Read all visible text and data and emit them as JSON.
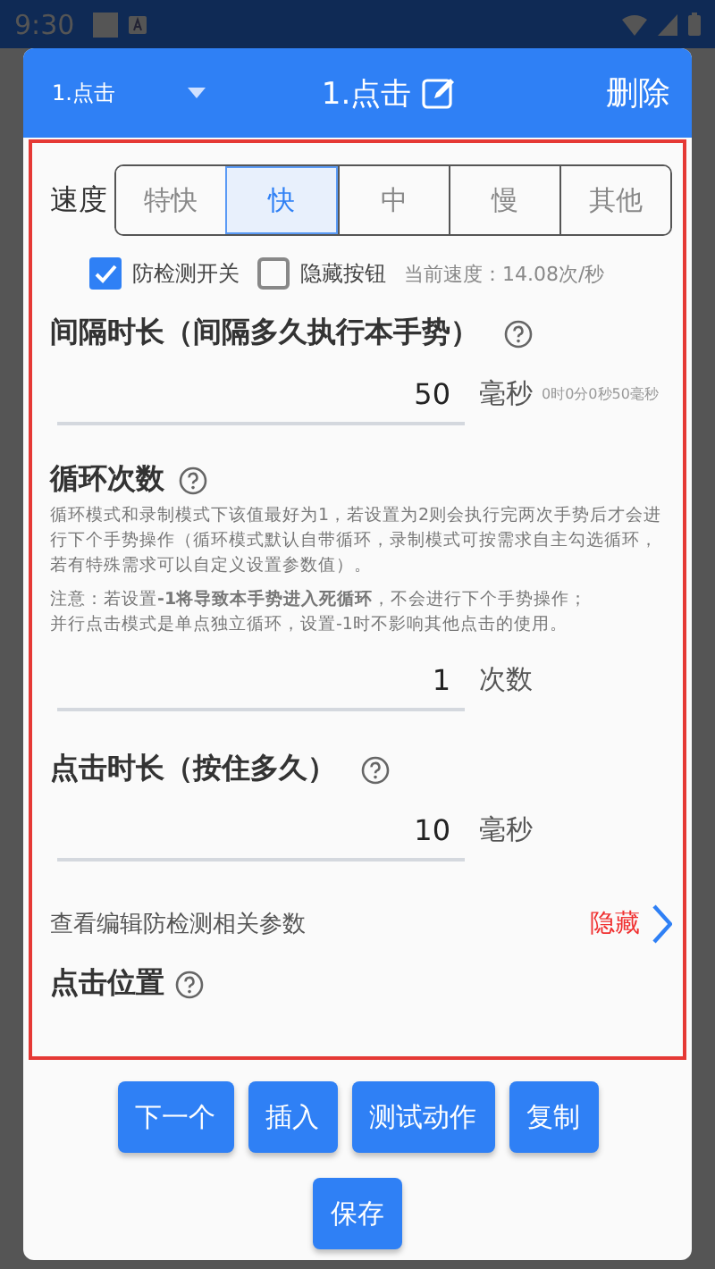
{
  "status_bar": {
    "time": "9:30"
  },
  "header": {
    "dropdown": "1.点击",
    "title": "1.点击",
    "delete": "删除"
  },
  "speed": {
    "label": "速度",
    "options": [
      {
        "label": "特快",
        "selected": false
      },
      {
        "label": "快",
        "selected": true
      },
      {
        "label": "中",
        "selected": false
      },
      {
        "label": "慢",
        "selected": false
      },
      {
        "label": "其他",
        "selected": false
      }
    ]
  },
  "checkboxes": [
    {
      "label": "防检测开关",
      "checked": true
    },
    {
      "label": "隐藏按钮",
      "checked": false
    }
  ],
  "current_speed": "当前速度：14.08次/秒",
  "interval": {
    "title": "间隔时长（间隔多久执行本手势）",
    "value": "50",
    "unit": "毫秒",
    "note": "0时0分0秒50毫秒"
  },
  "loop": {
    "title": "循环次数",
    "description": "循环模式和录制模式下该值最好为1，若设置为2则会执行完两次手势后才会进行下个手势操作（循环模式默认自带循环，录制模式可按需求自主勾选循环，若有特殊需求可以自定义设置参数值）。",
    "warning": [
      "注意：若设置**-1将导致本手势进入死循环**，不会进行下个手势操作；",
      "并行点击模式是单点独立循环，设置-1时不影响其他点击的使用。"
    ],
    "value": "1",
    "unit": "次数"
  },
  "click_duration": {
    "title": "点击时长（按住多久）",
    "value": "10",
    "unit": "毫秒"
  },
  "anti_detect": {
    "label": "查看编辑防检测相关参数",
    "action": "隐藏"
  },
  "position": {
    "title": "点击位置"
  },
  "buttons": [
    "下一个",
    "插入",
    "测试动作",
    "复制"
  ],
  "save": "保存"
}
